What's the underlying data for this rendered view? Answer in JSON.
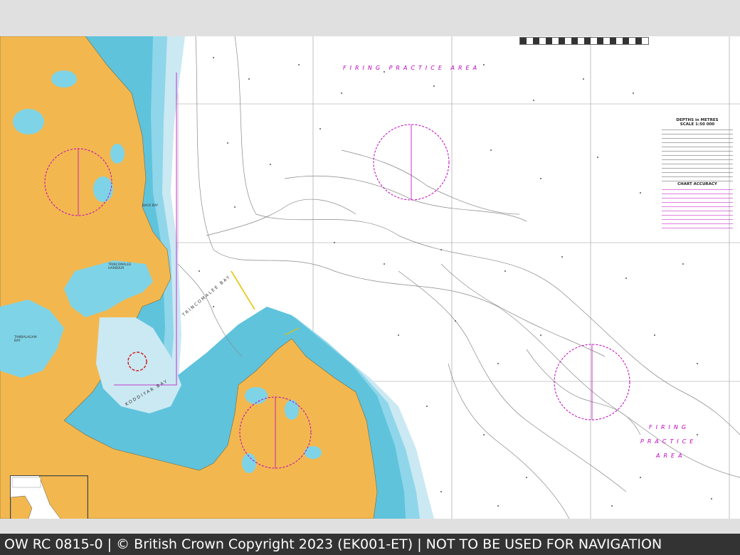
{
  "footer": {
    "text": "OW RC 0815-0 | © British Crown Copyright 2023 (EK001-ET) | NOT TO BE USED FOR NAVIGATION"
  },
  "chart": {
    "firing_area_label_top": "FIRING PRACTICE AREA",
    "firing_area_label_right": [
      "FIRING",
      "PRACTICE",
      "AREA"
    ],
    "place_names": {
      "harbour": "TRINCOMALEE HARBOUR",
      "bay": "TRINCOMALEE BAY",
      "inner_bay": "TAMBALAGAM BAY",
      "back_bay": "BACK BAY",
      "koddiyar": "KODDIYAR BAY"
    },
    "notes": {
      "title": "DEPTHS in METRES",
      "scale": "SCALE 1:50 000",
      "section": "CHART ACCURACY"
    }
  },
  "colors": {
    "land": "#f2b84f",
    "shallow": "#7fd3e6",
    "medium": "#b6e4f0",
    "sea": "#ffffff",
    "magenta": "#c000c0",
    "footer_bg": "#333333"
  }
}
